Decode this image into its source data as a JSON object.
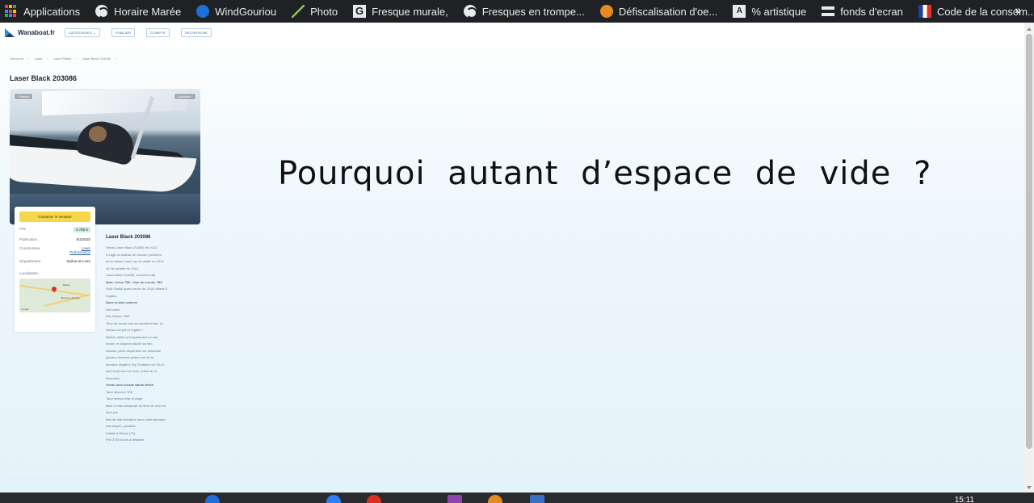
{
  "bookmarks": [
    {
      "label": "Applications",
      "icon": "apps-grid-icon"
    },
    {
      "label": "Horaire Marée",
      "icon": "globe-icon"
    },
    {
      "label": "WindGouriou",
      "icon": "windgouriou-icon"
    },
    {
      "label": "Photo",
      "icon": "photo-icon"
    },
    {
      "label": "Fresque murale,",
      "icon": "fresque-icon"
    },
    {
      "label": "Fresques en trompe...",
      "icon": "globe-icon"
    },
    {
      "label": "Défiscalisation d'oe...",
      "icon": "defiscalisation-icon"
    },
    {
      "label": "% artistique",
      "icon": "art-icon"
    },
    {
      "label": "fonds d'ecran",
      "icon": "fonds-icon"
    },
    {
      "label": "Code de la consom...",
      "icon": "flag-icon"
    }
  ],
  "bookmarks_more": "»",
  "site": {
    "logo": "Wanaboat.fr",
    "nav": [
      "CATÉGORIES ⌄",
      "PUBLIER",
      "COMPTE",
      "RECHERCHE"
    ]
  },
  "breadcrumb": [
    "Dériveurs",
    "›",
    "Laser",
    "›",
    "Laser Radial",
    "›",
    "Laser Black 203086",
    "›"
  ],
  "listing": {
    "title": "Laser Black 203086",
    "back_btn": "‹ Retour",
    "photos_btn": "4 photos ›",
    "contact_btn": "Contacter le vendeur",
    "info": {
      "price_label": "Prix",
      "price": "3 700 €",
      "publication_label": "Publication",
      "publication": "9/3/2020",
      "builder_label": "Constructeur",
      "builder_1": "Laser",
      "builder_2": "Performance",
      "department_label": "Département",
      "department": "Saône-et-Loire",
      "location_label": "Localisation"
    },
    "map_labels": [
      "Mâcon",
      "Bourg-en-Bresse",
      "Google"
    ],
    "description_title": "Laser Black 203086",
    "description": [
      {
        "text": "Vends Laser Black 203086 de 2012.",
        "em": false
      },
      {
        "text": "Il s'agit du bateau de l'ancien président",
        "em": false
      },
      {
        "text": "de la classe Laser, qui l'a utilisé en 2012.",
        "em": false
      },
      {
        "text": "Je l'ai racheté en 2015.",
        "em": false
      },
      {
        "text": "Laser Black 203086, excellent état",
        "em": false
      },
      {
        "text": "Mats / bôme TBE. Haut de mat alu TBE",
        "em": true
      },
      {
        "text": "Voile Radial quasi neuve de 2018 utilisée 3",
        "em": false
      },
      {
        "text": "régates.",
        "em": false
      },
      {
        "text": "Barre et stick carbone.",
        "em": true
      },
      {
        "text": "Dérouette.",
        "em": false
      },
      {
        "text": "Kits Harken TBE",
        "em": false
      },
      {
        "text": "Tous les bouts sont en excellent état. Le",
        "em": false
      },
      {
        "text": "bateau est prêt à régater !",
        "em": false
      },
      {
        "text": "Bateau utilisé principalement en eau",
        "em": false
      },
      {
        "text": "douce, et toujours stocké au sec.",
        "em": false
      },
      {
        "text": "Dossier photo disponible sur demande",
        "em": false
      },
      {
        "text": "(photos récentes prises lors de la",
        "em": false
      },
      {
        "text": "dernière régate à Vry Chatillon nov 2019,",
        "em": false
      },
      {
        "text": "sauf la photos sur l'eau, prises à La",
        "em": false
      },
      {
        "text": "Rochelle)",
        "em": false
      },
      {
        "text": "Vendu avec housse safran dérive.",
        "em": true
      },
      {
        "text": "Taud dessous TBE",
        "em": false
      },
      {
        "text": "Taud dessus état d'usage",
        "em": false
      },
      {
        "text": "Mise à l'eau artisanale en fibre de verre et",
        "em": false
      },
      {
        "text": "tube pvc",
        "em": false
      },
      {
        "text": "Bas de mat standard, avec voile standard",
        "em": false
      },
      {
        "text": "état moyen, possible.",
        "em": false
      },
      {
        "text": "Visible à Mâcon (71).",
        "em": false
      },
      {
        "text": "Prix 3700 euros à débattre.",
        "em": false
      }
    ]
  },
  "annotation": "Pourquoi  autant  d’espace  de  vide  ?",
  "taskbar": {
    "clock": "15:11"
  },
  "colors": {
    "bookmark_bar": "#202124",
    "accent_yellow": "#f7d64a",
    "price_green": "#cdeed7",
    "link_blue": "#2b5f9a"
  }
}
